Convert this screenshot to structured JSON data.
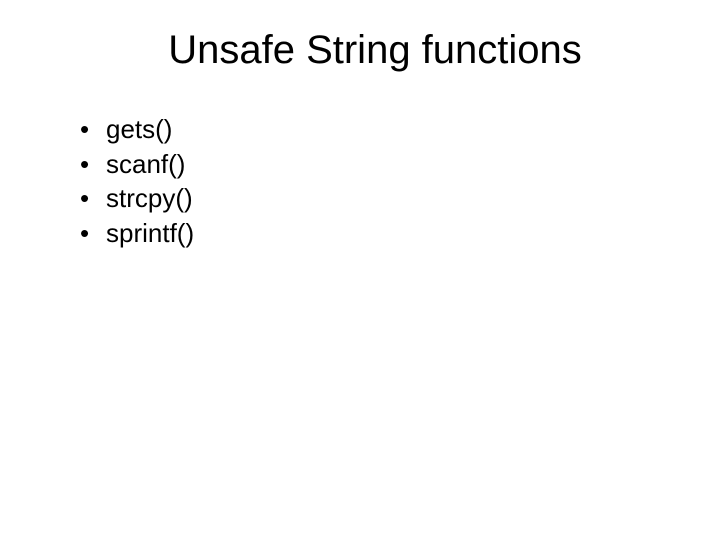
{
  "slide": {
    "title": "Unsafe String functions",
    "bullets": [
      {
        "text": "gets()"
      },
      {
        "text": "scanf()"
      },
      {
        "text": "strcpy()"
      },
      {
        "text": "sprintf()"
      }
    ]
  }
}
